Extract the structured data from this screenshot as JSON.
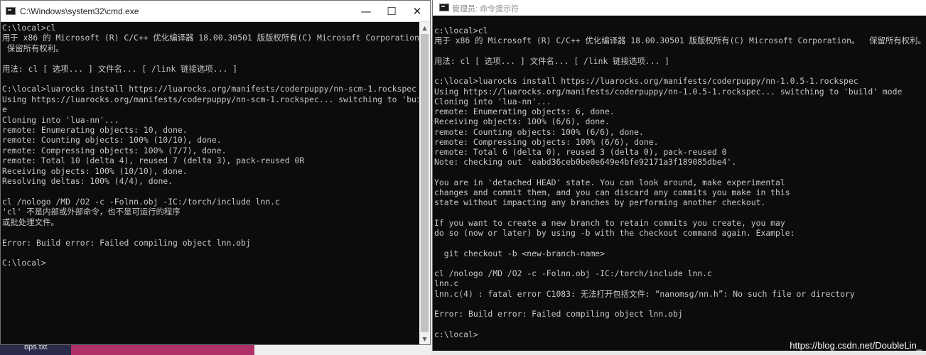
{
  "desktop": {
    "file_label": "bps.txt"
  },
  "window1": {
    "title": "C:\\Windows\\system32\\cmd.exe",
    "controls": {
      "minimize": "—",
      "maximize": "☐",
      "close": "✕"
    },
    "console_lines": [
      "C:\\local>cl",
      "用于 x86 的 Microsoft (R) C/C++ 优化编译器 18.00.30501 版版权所有(C) Microsoft Corporation。",
      " 保留所有权利。",
      "",
      "用法: cl [ 选项... ] 文件名... [ /link 链接选项... ]",
      "",
      "C:\\local>luarocks install https://luarocks.org/manifests/coderpuppy/nn-scm-1.rockspec",
      "Using https://luarocks.org/manifests/coderpuppy/nn-scm-1.rockspec... switching to 'build' mod",
      "e",
      "Cloning into 'lua-nn'...",
      "remote: Enumerating objects: 10, done.",
      "remote: Counting objects: 100% (10/10), done.",
      "remote: Compressing objects: 100% (7/7), done.",
      "remote: Total 10 (delta 4), reused 7 (delta 3), pack-reused 0R",
      "Receiving objects: 100% (10/10), done.",
      "Resolving deltas: 100% (4/4), done.",
      "",
      "cl /nologo /MD /O2 -c -Folnn.obj -IC:/torch/include lnn.c",
      "'cl' 不是内部或外部命令，也不是可运行的程序",
      "或批处理文件。",
      "",
      "Error: Build error: Failed compiling object lnn.obj",
      "",
      "C:\\local>"
    ]
  },
  "window2": {
    "title": "管理员: 命令提示符",
    "console_lines": [
      "c:\\local>cl",
      "用于 x86 的 Microsoft (R) C/C++ 优化编译器 18.00.30501 版版权所有(C) Microsoft Corporation。  保留所有权利。",
      "",
      "用法: cl [ 选项... ] 文件名... [ /link 链接选项... ]",
      "",
      "c:\\local>luarocks install https://luarocks.org/manifests/coderpuppy/nn-1.0.5-1.rockspec",
      "Using https://luarocks.org/manifests/coderpuppy/nn-1.0.5-1.rockspec... switching to 'build' mode",
      "Cloning into 'lua-nn'...",
      "remote: Enumerating objects: 6, done.",
      "Receiving objects: 100% (6/6), done.",
      "remote: Counting objects: 100% (6/6), done.",
      "remote: Compressing objects: 100% (6/6), done.",
      "remote: Total 6 (delta 0), reused 3 (delta 0), pack-reused 0",
      "Note: checking out 'eabd36ceb0be0e649e4bfe92171a3f189085dbe4'.",
      "",
      "You are in 'detached HEAD' state. You can look around, make experimental",
      "changes and commit them, and you can discard any commits you make in this",
      "state without impacting any branches by performing another checkout.",
      "",
      "If you want to create a new branch to retain commits you create, you may",
      "do so (now or later) by using -b with the checkout command again. Example:",
      "",
      "  git checkout -b <new-branch-name>",
      "",
      "cl /nologo /MD /O2 -c -Folnn.obj -IC:/torch/include lnn.c",
      "lnn.c",
      "lnn.c(4) : fatal error C1083: 无法打开包括文件: “nanomsg/nn.h”: No such file or directory",
      "",
      "Error: Build error: Failed compiling object lnn.obj",
      "",
      "c:\\local>"
    ]
  },
  "watermark": "https://blog.csdn.net/DoubleLin_"
}
